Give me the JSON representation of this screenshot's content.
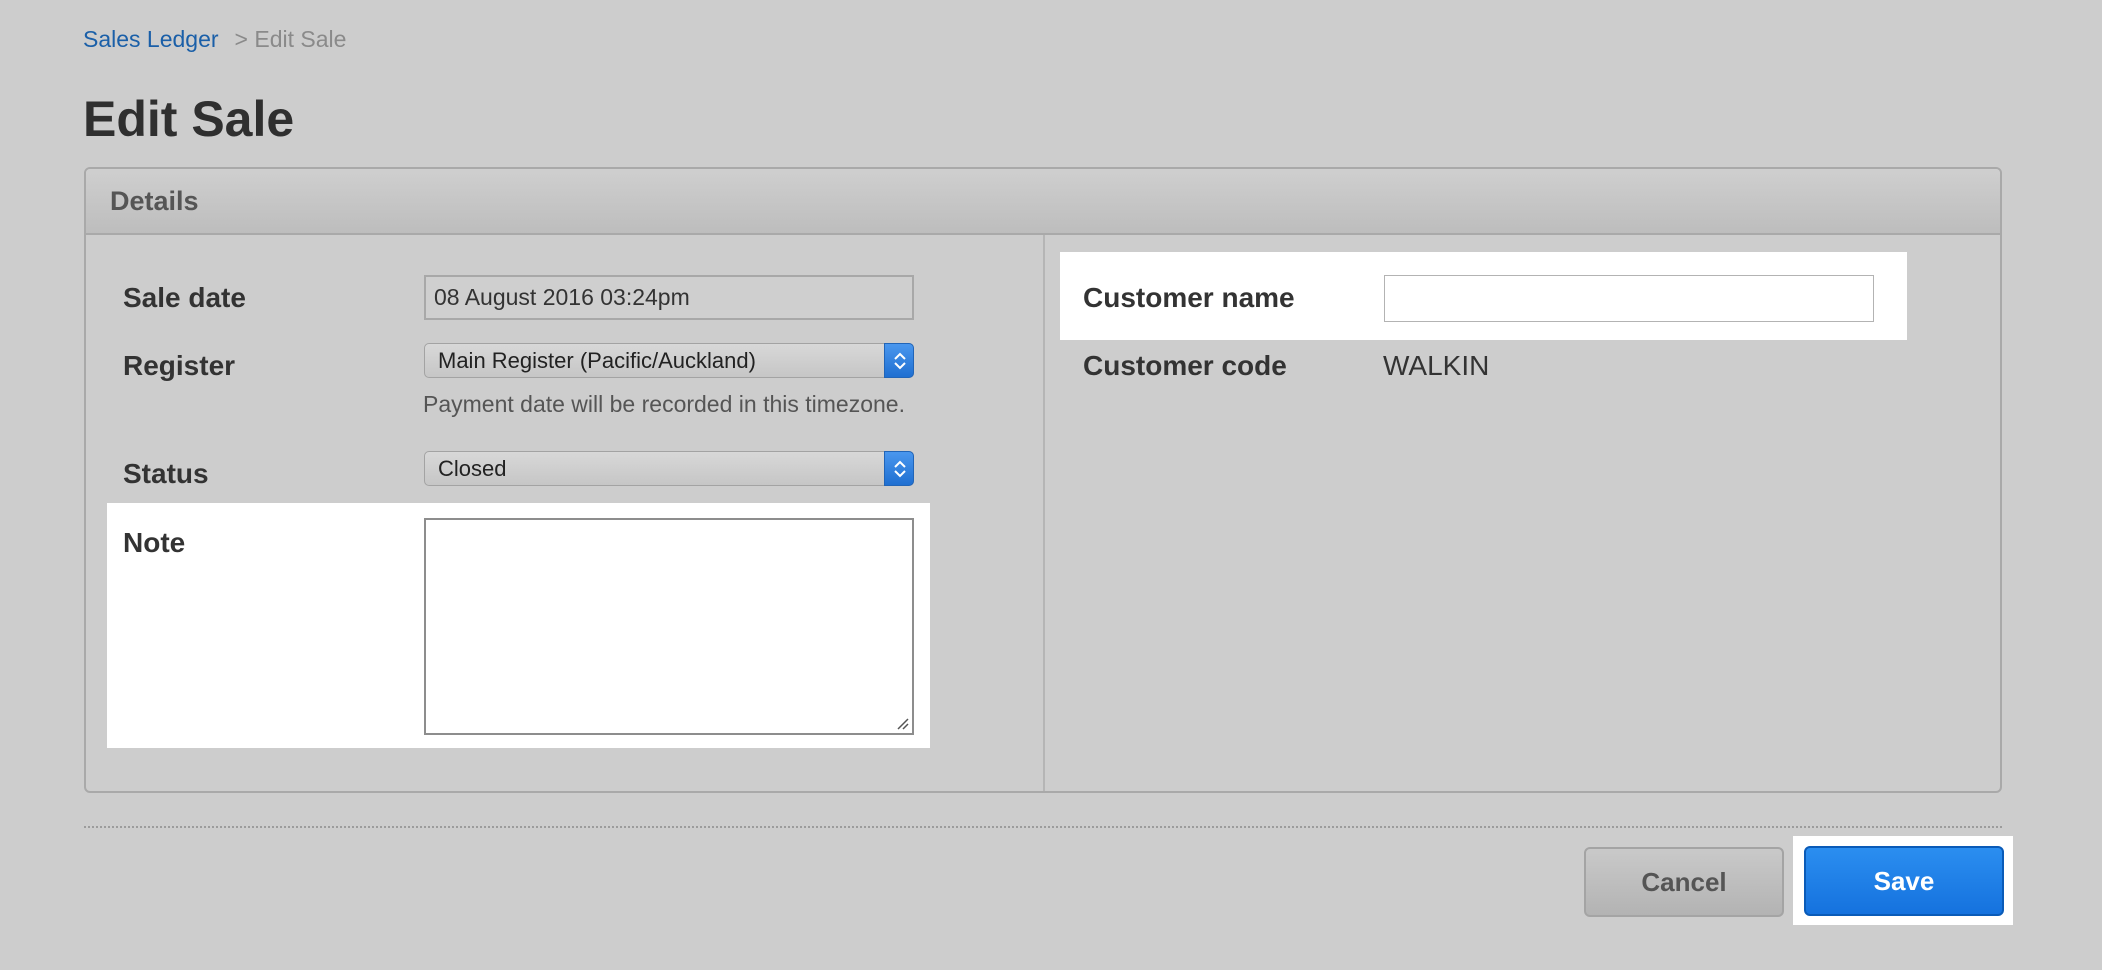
{
  "breadcrumb": {
    "parent": "Sales Ledger",
    "current": "> Edit Sale"
  },
  "page": {
    "title": "Edit Sale"
  },
  "panel": {
    "title": "Details"
  },
  "form": {
    "sale_date": {
      "label": "Sale date",
      "value": "08 August 2016 03:24pm"
    },
    "register": {
      "label": "Register",
      "selected": "Main Register (Pacific/Auckland)",
      "hint": "Payment date will be recorded in this timezone."
    },
    "status": {
      "label": "Status",
      "selected": "Closed"
    },
    "note": {
      "label": "Note",
      "value": ""
    },
    "customer_name": {
      "label": "Customer name",
      "value": ""
    },
    "customer_code": {
      "label": "Customer code",
      "value": "WALKIN"
    }
  },
  "actions": {
    "cancel_label": "Cancel",
    "save_label": "Save"
  },
  "colors": {
    "accent": "#1a77e0",
    "link": "#1a5fa8",
    "background": "#cdcdcd"
  }
}
